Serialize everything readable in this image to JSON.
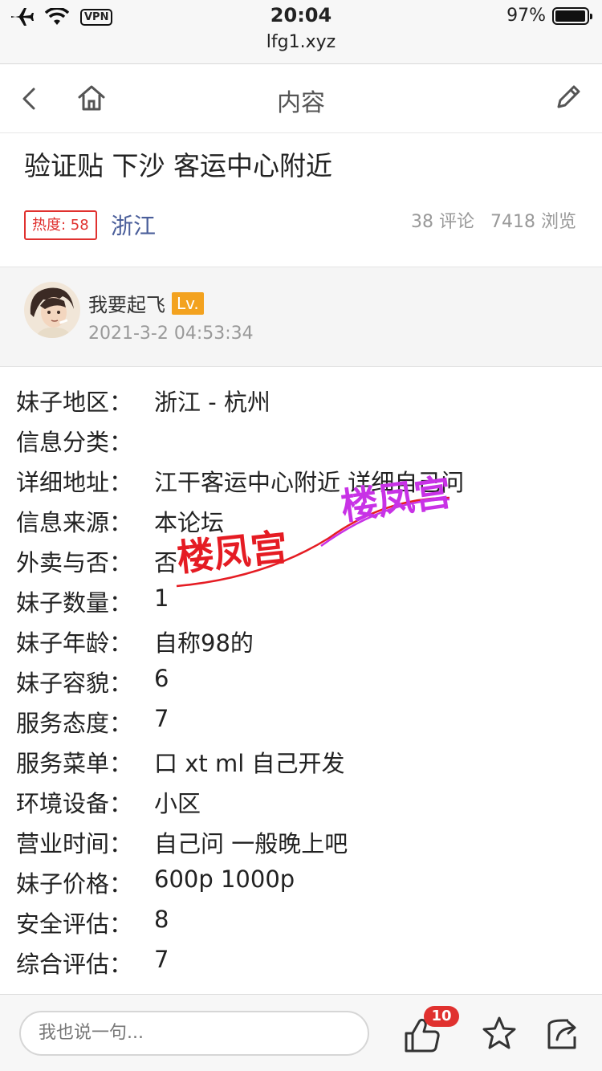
{
  "status_bar": {
    "vpn": "VPN",
    "time": "20:04",
    "url": "lfg1.xyz",
    "battery": "97%",
    "battery_level": 0.97
  },
  "nav": {
    "title": "内容",
    "back_icon": "chevron-left-icon",
    "home_icon": "home-icon",
    "edit_icon": "pencil-icon"
  },
  "article": {
    "title": "验证贴 下沙 客运中心附近",
    "heat": "热度: 58",
    "region": "浙江",
    "comments": "38 评论",
    "views": "7418 浏览"
  },
  "author": {
    "name": "我要起飞",
    "level": "Lv.",
    "time": "2021-3-2 04:53:34"
  },
  "fields": [
    {
      "label": "妹子地区：",
      "value": "浙江 - 杭州"
    },
    {
      "label": "信息分类：",
      "value": ""
    },
    {
      "label": "详细地址：",
      "value": "江干客运中心附近 详细自己问"
    },
    {
      "label": "信息来源：",
      "value": "本论坛"
    },
    {
      "label": "外卖与否：",
      "value": "否"
    },
    {
      "label": "妹子数量：",
      "value": "1"
    },
    {
      "label": "妹子年龄：",
      "value": "自称98的"
    },
    {
      "label": "妹子容貌：",
      "value": "6"
    },
    {
      "label": "服务态度：",
      "value": "7"
    },
    {
      "label": "服务菜单：",
      "value": "口 xt ml 自己开发"
    },
    {
      "label": "环境设备：",
      "value": "小区"
    },
    {
      "label": "营业时间：",
      "value": "自己问 一般晚上吧"
    },
    {
      "label": "妹子价格：",
      "value": "600p  1000p"
    },
    {
      "label": "安全评估：",
      "value": "8"
    },
    {
      "label": "综合评估：",
      "value": "7"
    }
  ],
  "watermark": {
    "text1": "楼凤宫",
    "text2": "楼凤宫",
    "color1": "#e51c23",
    "color2": "#c832e6"
  },
  "bottom": {
    "placeholder": "我也说一句...",
    "like_count": "10",
    "like_icon": "thumbs-up-icon",
    "star_icon": "star-icon",
    "share_icon": "share-icon"
  },
  "colors": {
    "accent_red": "#e0312f",
    "region_blue": "#4a5e9a",
    "level_orange": "#f3a21f"
  }
}
